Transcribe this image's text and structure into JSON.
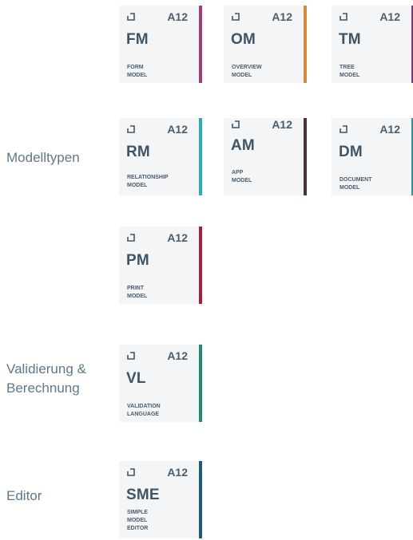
{
  "brand": "A12",
  "sections": [
    {
      "label": "Modelltypen"
    },
    {
      "label": "Validierung &\nBerechnung"
    },
    {
      "label": "Editor"
    }
  ],
  "tiles": [
    {
      "abbr": "FM",
      "name": "FORM\nMODEL",
      "color": "#a23a7c"
    },
    {
      "abbr": "OM",
      "name": "OVERVIEW\nMODEL",
      "color": "#d48a3a"
    },
    {
      "abbr": "TM",
      "name": "TREE\nMODEL",
      "color": "#7a3a7c"
    },
    {
      "abbr": "RM",
      "name": "RELATIONSHIP\nMODEL",
      "color": "#2ab0b4"
    },
    {
      "abbr": "AM",
      "name": "APP\nMODEL",
      "color": "#4a3335"
    },
    {
      "abbr": "DM",
      "name": "DOCUMENT\nMODEL",
      "color": "#2b8fa8"
    },
    {
      "abbr": "PM",
      "name": "PRINT\nMODEL",
      "color": "#a3203a"
    },
    {
      "abbr": "VL",
      "name": "VALIDATION\nLANGUAGE",
      "color": "#1e8a78"
    },
    {
      "abbr": "SME",
      "name": "SIMPLE\nMODEL\nEDITOR",
      "color": "#1e5a7c"
    }
  ]
}
